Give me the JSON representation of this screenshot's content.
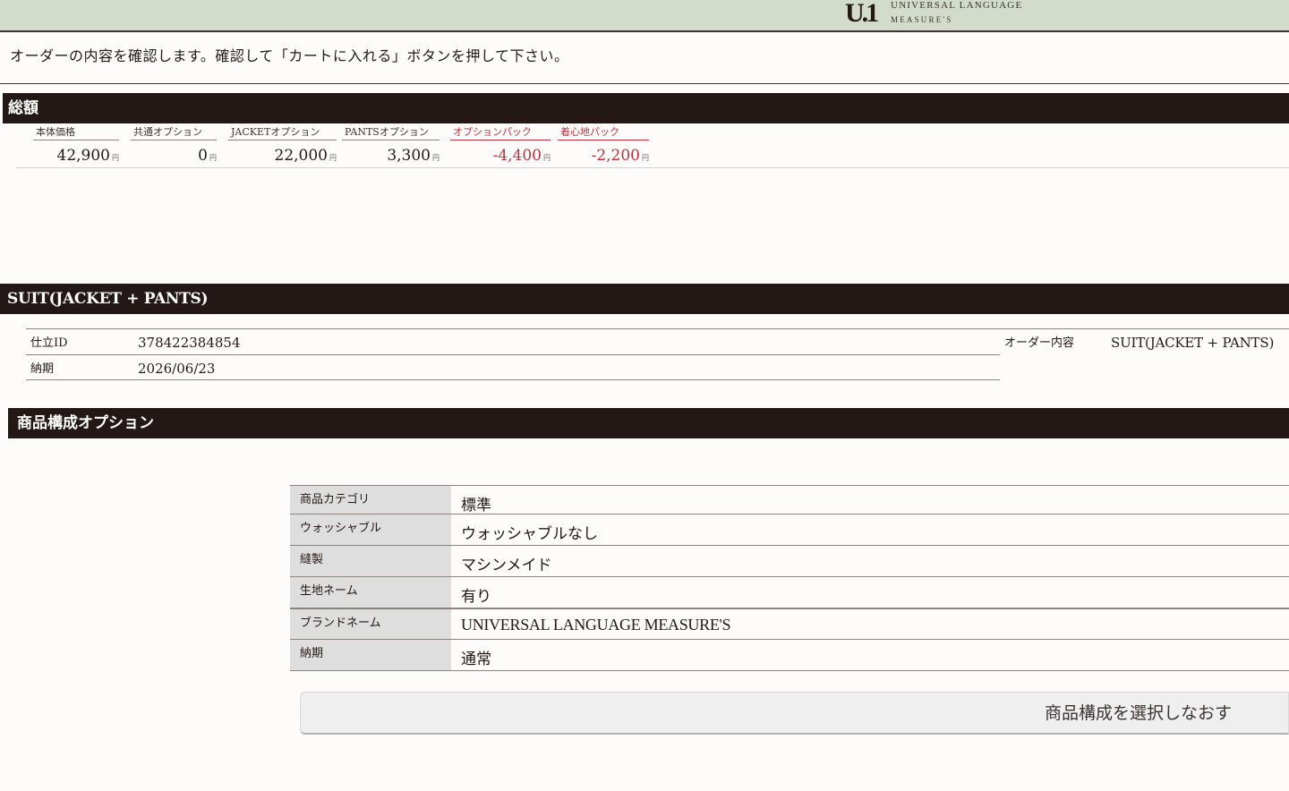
{
  "header": {
    "logo_mark": "U.1",
    "logo_line1": "UNIVERSAL LANGUAGE",
    "logo_line2": "MEASURE'S"
  },
  "notice": "オーダーの内容を確認します。確認して「カートに入れる」ボタンを押して下さい。",
  "totals": {
    "title": "総額",
    "currency": "円",
    "items": [
      {
        "label": "本体価格",
        "value": "42,900",
        "red": false
      },
      {
        "label": "共通オプション",
        "value": "0",
        "red": false
      },
      {
        "label": "JACKETオプション",
        "value": "22,000",
        "red": false
      },
      {
        "label": "PANTSオプション",
        "value": "3,300",
        "red": false
      },
      {
        "label": "オプションパック",
        "value": "-4,400",
        "red": true
      },
      {
        "label": "着心地パック",
        "value": "-2,200",
        "red": true
      }
    ],
    "colors": {
      "discount": "#c0303a"
    }
  },
  "suit": {
    "title": "SUIT(JACKET + PANTS)",
    "fields": [
      {
        "label": "仕立ID",
        "value": "378422384854"
      },
      {
        "label": "納期",
        "value": "2026/06/23"
      }
    ],
    "order_label": "オーダー内容",
    "order_value": "SUIT(JACKET + PANTS)"
  },
  "options": {
    "title": "商品構成オプション",
    "rows": [
      {
        "label": "商品カテゴリ",
        "value": "標準"
      },
      {
        "label": "ウォッシャブル",
        "value": "ウォッシャブルなし"
      },
      {
        "label": "縫製",
        "value": "マシンメイド"
      },
      {
        "label": "生地ネーム",
        "value": "有り"
      },
      {
        "label": "ブランドネーム",
        "value": "UNIVERSAL LANGUAGE MEASURE'S"
      },
      {
        "label": "納期",
        "value": "通常"
      }
    ],
    "reselect_label": "商品構成を選択しなおす"
  }
}
